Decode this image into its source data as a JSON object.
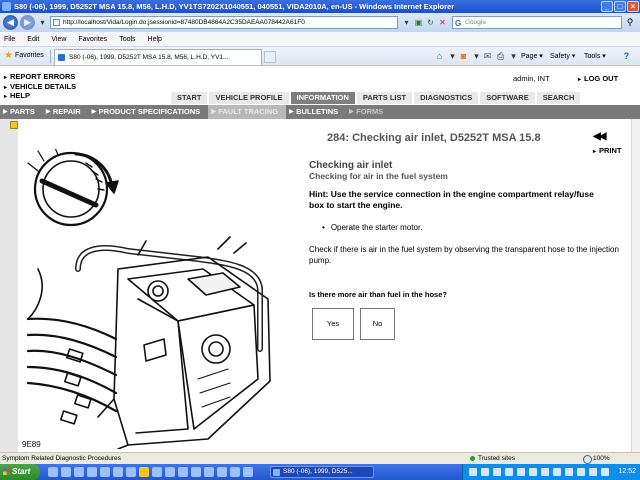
{
  "window": {
    "title": "S80 (-06), 1999, D5252T MSA 15.8, M56, L.H.D, YV1TS7202X1040551, 040551, VIDA2010A, en-US - Windows Internet Explorer",
    "min": "_",
    "max": "□",
    "close": "×"
  },
  "address": {
    "url": "http://localhost/Vida/Login.do;jsessionid=87480DB4864A2C35DAEAA078442A61F0",
    "search_placeholder": "Google"
  },
  "menu": [
    "File",
    "Edit",
    "View",
    "Favorites",
    "Tools",
    "Help"
  ],
  "favbar": {
    "favorites_label": "Favorites",
    "tab_title": "S80 (-06), 1999, D5252T MSA 15.8, M56, L.H.D, YV1...",
    "page_label": "Page ▾",
    "safety_label": "Safety ▾",
    "tools_label": "Tools ▾",
    "help_icon": "?"
  },
  "app": {
    "toplinks": [
      "REPORT ERRORS",
      "VEHICLE DETAILS",
      "HELP"
    ],
    "user": "admin, INT",
    "logout": "LOG OUT",
    "main_tabs": [
      {
        "label": "START",
        "active": false
      },
      {
        "label": "VEHICLE PROFILE",
        "active": false
      },
      {
        "label": "INFORMATION",
        "active": true
      },
      {
        "label": "PARTS LIST",
        "active": false
      },
      {
        "label": "DIAGNOSTICS",
        "active": false
      },
      {
        "label": "SOFTWARE",
        "active": false
      },
      {
        "label": "SEARCH",
        "active": false
      }
    ],
    "sub_nav": [
      {
        "label": "PARTS",
        "state": "normal"
      },
      {
        "label": "REPAIR",
        "state": "normal"
      },
      {
        "label": "PRODUCT SPECIFICATIONS",
        "state": "normal"
      },
      {
        "label": "FAULT TRACING",
        "state": "active"
      },
      {
        "label": "BULLETINS",
        "state": "normal"
      },
      {
        "label": "FORMS",
        "state": "dim"
      }
    ]
  },
  "doc": {
    "title": "284: Checking air inlet, D5252T MSA 15.8",
    "pager": "◀◀",
    "print": "PRINT",
    "heading": "Checking air inlet",
    "subheading": "Checking for air in the fuel system",
    "hint": "Hint: Use the service connection in the engine compartment relay/fuse box to start the engine.",
    "bullet": "Operate the starter motor.",
    "paragraph": "Check if there is air in the fuel system by observing the transparent hose to the injection pump.",
    "question": "Is there more air than fuel in the hose?",
    "yes": "Yes",
    "no": "No",
    "illustration_label": "9E89"
  },
  "status": {
    "text": "Symptom Related Diagnostic Procedures",
    "zone": "Trusted sites",
    "zoom": "100%"
  },
  "taskbar": {
    "start": "Start",
    "window_item": "S80 (-06), 1999, D525...",
    "clock": "12:52"
  }
}
